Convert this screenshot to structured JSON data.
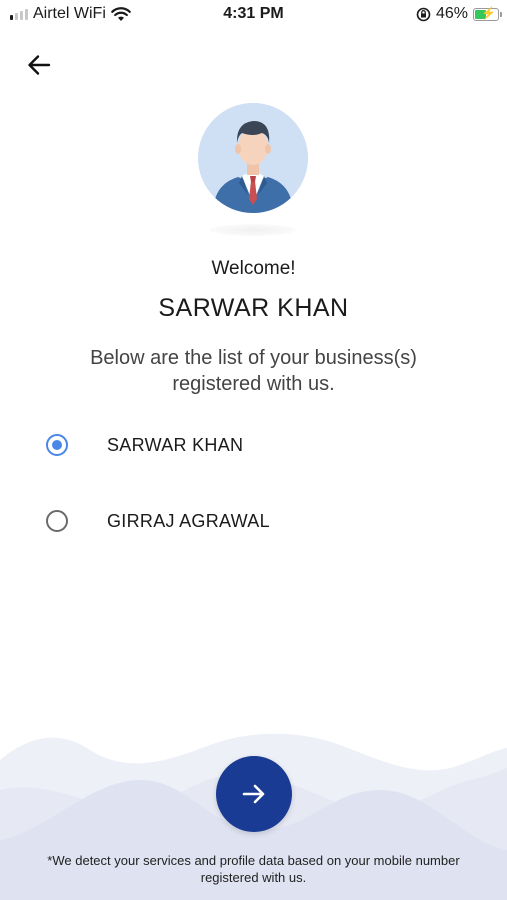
{
  "status_bar": {
    "carrier": "Airtel WiFi",
    "time": "4:31 PM",
    "battery_percent": "46%",
    "battery_level": 0.46,
    "icons": [
      "signal-icon",
      "wifi-icon",
      "orientation-lock-icon",
      "battery-charging-icon"
    ]
  },
  "header": {
    "back_icon": "arrow-left-icon"
  },
  "profile": {
    "avatar_icon": "businessman-avatar",
    "welcome_text": "Welcome!",
    "name": "SARWAR KHAN"
  },
  "description": "Below are the list of your business(s) registered with us.",
  "businesses": [
    {
      "label": "SARWAR KHAN",
      "selected": true
    },
    {
      "label": "GIRRAJ AGRAWAL",
      "selected": false
    }
  ],
  "next_button": {
    "icon": "arrow-right-icon"
  },
  "footnote": "*We detect your services and profile data based on your mobile number registered with us.",
  "colors": {
    "accent": "#4a86e8",
    "button": "#1a3b94",
    "wave_light": "#eef0f8",
    "wave_dark": "#dfe3f1"
  }
}
